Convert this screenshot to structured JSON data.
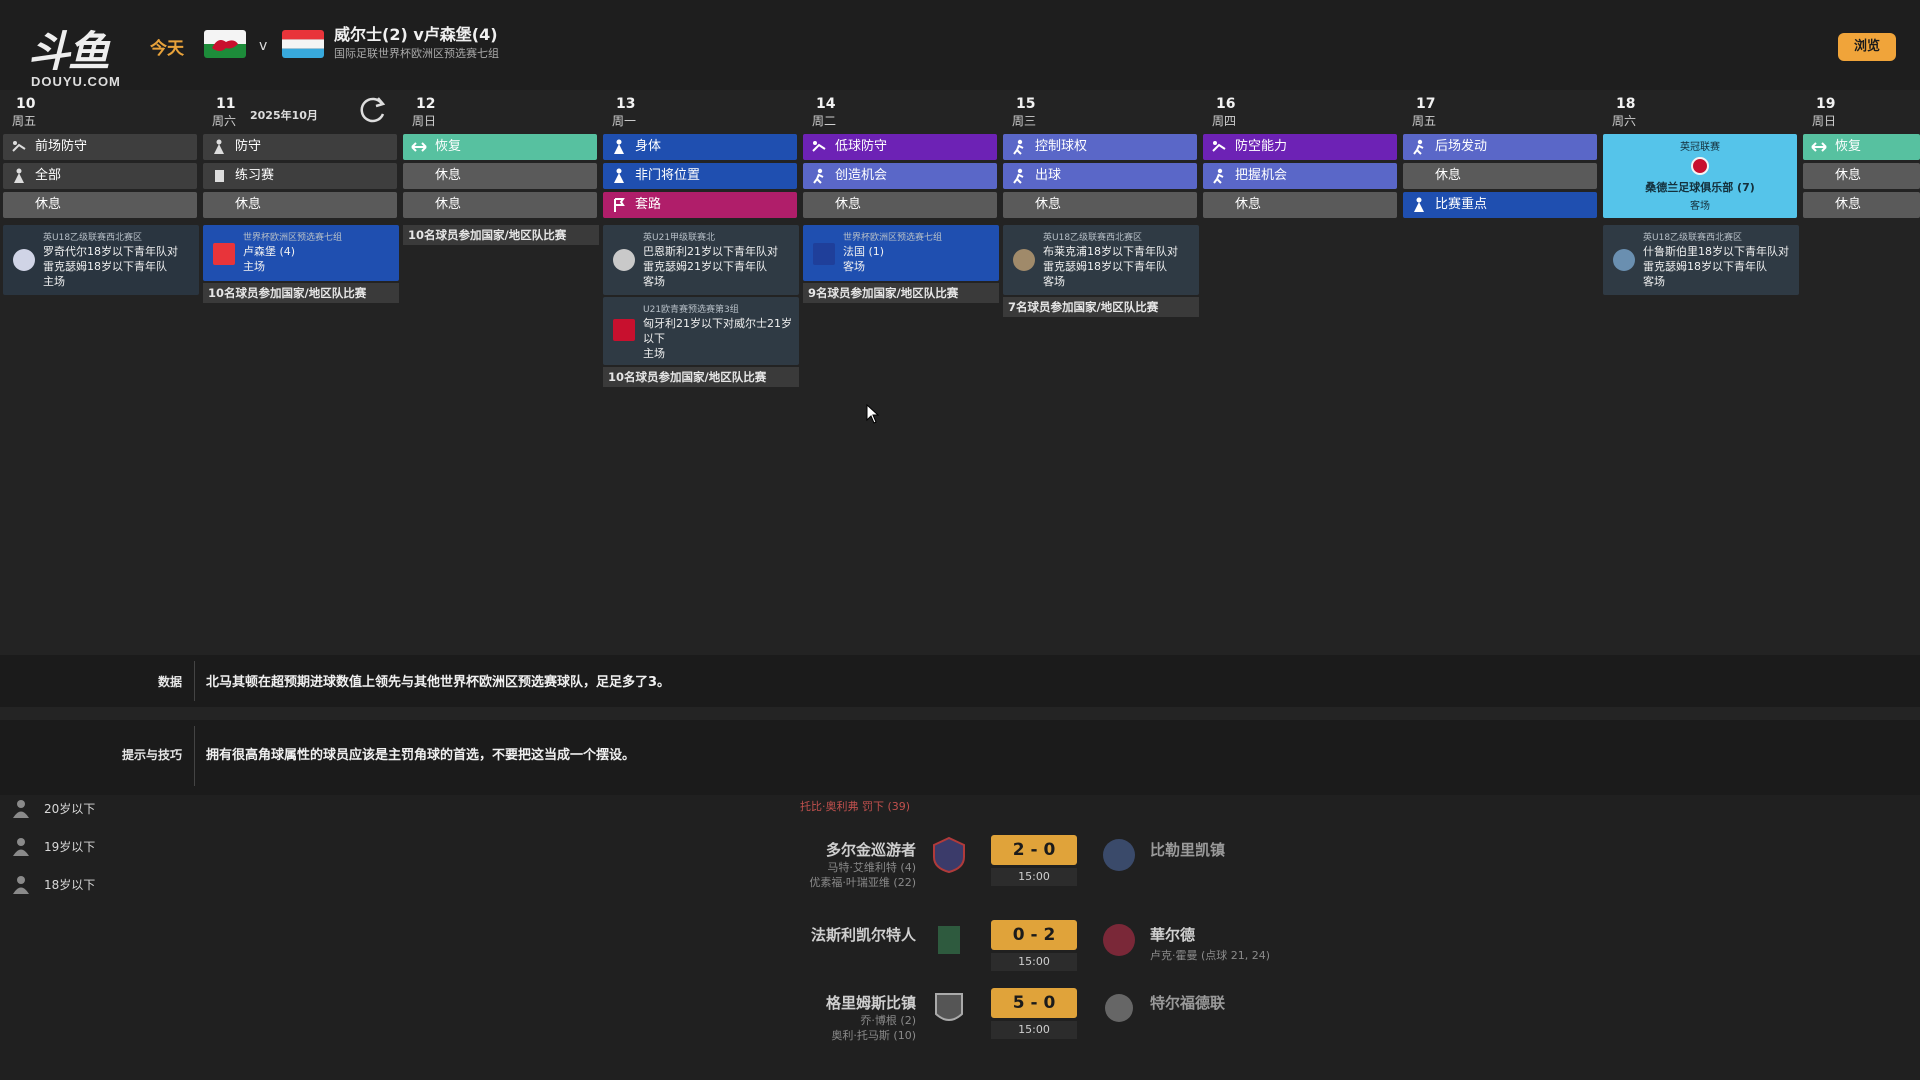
{
  "header": {
    "logo_main": "斗鱼",
    "logo_sub": "DOUYU.COM",
    "today_label": "今天",
    "vs": "v",
    "match_title": "威尔士(2) v卢森堡(4)",
    "match_subtitle": "国际足联世界杯欧洲区预选赛七组",
    "browse_label": "浏览"
  },
  "calendar": {
    "month_label": "2025年10月",
    "days": [
      {
        "num": "10",
        "weekday": "周五"
      },
      {
        "num": "11",
        "weekday": "周六"
      },
      {
        "num": "12",
        "weekday": "周日"
      },
      {
        "num": "13",
        "weekday": "周一"
      },
      {
        "num": "14",
        "weekday": "周二"
      },
      {
        "num": "15",
        "weekday": "周三"
      },
      {
        "num": "16",
        "weekday": "周四"
      },
      {
        "num": "17",
        "weekday": "周五"
      },
      {
        "num": "18",
        "weekday": "周六"
      },
      {
        "num": "19",
        "weekday": "周日"
      }
    ],
    "sessions": {
      "d10": [
        "前场防守",
        "全部",
        "休息"
      ],
      "d11": [
        "防守",
        "练习赛",
        "休息"
      ],
      "d12": [
        "恢复",
        "休息",
        "休息"
      ],
      "d13": [
        "身体",
        "非门将位置",
        "套路"
      ],
      "d14": [
        "低球防守",
        "创造机会",
        "休息"
      ],
      "d15": [
        "控制球权",
        "出球",
        "休息"
      ],
      "d16": [
        "防空能力",
        "把握机会",
        "休息"
      ],
      "d17": [
        "后场发动",
        "休息",
        "比赛重点"
      ],
      "d19": [
        "恢复",
        "休息",
        "休息"
      ]
    },
    "d18_event": {
      "comp": "英冠联赛",
      "line1": "桑德兰足球俱乐部 (7)",
      "line2": "客场"
    },
    "matches": {
      "d10": {
        "comp": "英U18乙级联赛西北赛区",
        "line1": "罗奇代尔18岁以下青年队对",
        "line2": "雷克瑟姆18岁以下青年队",
        "line3": "主场"
      },
      "d11": {
        "comp": "世界杯欧洲区预选赛七组",
        "line1": "卢森堡 (4)",
        "line2": "主场",
        "note": "10名球员参加国家/地区队比赛"
      },
      "d12_note": "10名球员参加国家/地区队比赛",
      "d13a": {
        "comp": "英U21甲级联赛北",
        "line1": "巴恩斯利21岁以下青年队对",
        "line2": "雷克瑟姆21岁以下青年队",
        "line3": "客场"
      },
      "d13b": {
        "comp": "U21欧青赛预选赛第3组",
        "line1": "匈牙利21岁以下对威尔士21岁",
        "line2": "以下",
        "line3": "主场",
        "note": "10名球员参加国家/地区队比赛"
      },
      "d14": {
        "comp": "世界杯欧洲区预选赛七组",
        "line1": "法国 (1)",
        "line2": "客场",
        "note": "9名球员参加国家/地区队比赛"
      },
      "d15": {
        "comp": "英U18乙级联赛西北赛区",
        "line1": "布莱克浦18岁以下青年队对",
        "line2": "雷克瑟姆18岁以下青年队",
        "line3": "客场",
        "note": "7名球员参加国家/地区队比赛"
      },
      "d18": {
        "comp": "英U18乙级联赛西北赛区",
        "line1": "什鲁斯伯里18岁以下青年队对",
        "line2": "雷克瑟姆18岁以下青年队",
        "line3": "客场"
      }
    }
  },
  "info": {
    "data_label": "数据",
    "data_text": "北马其顿在超预期进球数值上领先与其他世界杯欧洲区预选赛球队，足足多了3。",
    "tips_label": "提示与技巧",
    "tips_text": "拥有很高角球属性的球员应该是主罚角球的首选，不要把这当成一个摆设。"
  },
  "filters": [
    "20岁以下",
    "19岁以下",
    "18岁以下"
  ],
  "results": {
    "top_text": "托比·奥利弗 罚下 (39)",
    "rows": [
      {
        "home": "多尔金巡游者",
        "home_scorers": [
          "马特·艾维利特 (4)",
          "优素福·叶瑞亚维 (22)"
        ],
        "score": "2 - 0",
        "time": "15:00",
        "away": "比勒里凯镇",
        "away_scorers": ""
      },
      {
        "home": "法斯利凯尔特人",
        "home_scorers": [],
        "score": "0 - 2",
        "time": "15:00",
        "away": "華尔德",
        "away_scorers": "卢克·霍曼 (点球 21, 24)"
      },
      {
        "home": "格里姆斯比镇",
        "home_scorers": [
          "乔·博根 (2)",
          "奥利·托马斯 (10)"
        ],
        "score": "5 - 0",
        "time": "15:00",
        "away": "特尔福德联",
        "away_scorers": ""
      }
    ]
  },
  "colors": {
    "accent": "#e0a33a",
    "teal": "#57c1a0",
    "blue": "#1f4fb0",
    "purple": "#6d22b5",
    "lavender": "#5a67c8",
    "magenta": "#b01e6a",
    "cyan": "#55c4ea",
    "grey": "#5a5a5a"
  }
}
